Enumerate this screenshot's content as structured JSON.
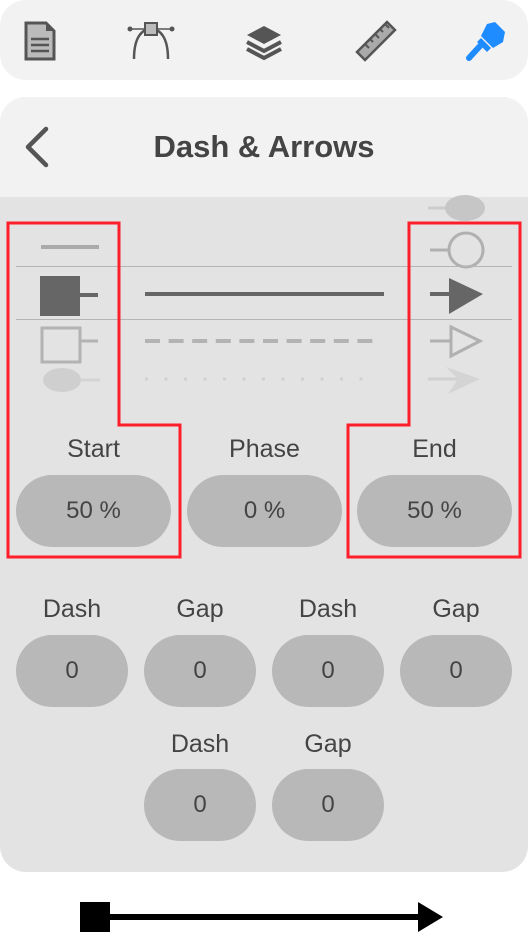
{
  "toolbar": {
    "items": [
      {
        "icon": "document-icon"
      },
      {
        "icon": "bezier-icon"
      },
      {
        "icon": "layers-icon"
      },
      {
        "icon": "ruler-icon"
      },
      {
        "icon": "brush-icon",
        "active": true
      }
    ],
    "active_color": "#1e8cff"
  },
  "header": {
    "title": "Dash & Arrows",
    "back_icon": "chevron-left-icon"
  },
  "picker": {
    "start_selected": "square-filled",
    "line_selected": "solid",
    "end_selected": "arrow-filled"
  },
  "range": {
    "start": {
      "label": "Start",
      "value": "50 %"
    },
    "phase": {
      "label": "Phase",
      "value": "0 %"
    },
    "end": {
      "label": "End",
      "value": "50 %"
    }
  },
  "dashes": [
    {
      "label": "Dash",
      "value": "0"
    },
    {
      "label": "Gap",
      "value": "0"
    },
    {
      "label": "Dash",
      "value": "0"
    },
    {
      "label": "Gap",
      "value": "0"
    },
    {
      "label": "Dash",
      "value": "0"
    },
    {
      "label": "Gap",
      "value": "0"
    }
  ],
  "highlight_color": "#ff1e2a"
}
